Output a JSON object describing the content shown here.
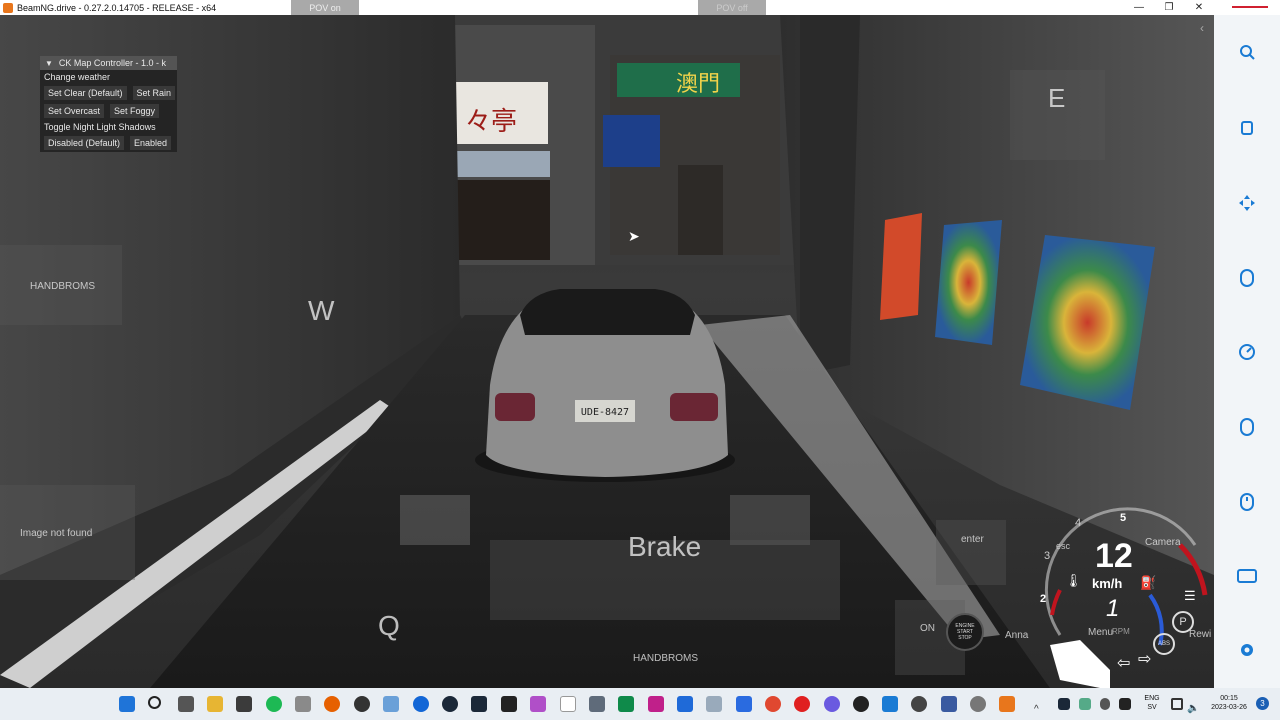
{
  "window": {
    "title": "BeamNG.drive - 0.27.2.0.14705 - RELEASE - x64",
    "controls": [
      "—",
      "❐",
      "✕"
    ]
  },
  "pov": {
    "on_label": "POV on",
    "off_label": "POV off"
  },
  "ck_panel": {
    "title": "CK Map Controller - 1.0 - k",
    "weather_label": "Change weather",
    "btn_clear": "Set Clear (Default)",
    "btn_rain": "Set Rain",
    "btn_overcast": "Set Overcast",
    "btn_foggy": "Set Foggy",
    "shadows_label": "Toggle Night Light Shadows",
    "btn_disabled": "Disabled (Default)",
    "btn_enabled": "Enabled"
  },
  "controls_overlay": {
    "key_e": "E",
    "key_w": "W",
    "key_q": "Q",
    "brake": "Brake",
    "handbrake_left": "HANDBROMS",
    "handbrake_bottom": "HANDBROMS",
    "image_missing": "Image not found",
    "enter": "enter",
    "esc": "esc",
    "camera": "Camera",
    "on": "ON",
    "engine": "ENGINE START STOP",
    "anna": "Anna",
    "menu": "Menu",
    "rewind": "Rewi"
  },
  "dashboard": {
    "speed": "12",
    "unit": "km/h",
    "gear": "1",
    "rpm_label": "RPM",
    "tach_marks": [
      "2",
      "3",
      "4",
      "5"
    ],
    "parking": "P",
    "abs": "ABS"
  },
  "scene": {
    "plate": "UDE-8427",
    "shop_sign": "澳門",
    "restaurant_sign": "々亭"
  },
  "taskbar": {
    "lang_top": "ENG",
    "lang_bottom": "SV",
    "time": "00:15",
    "date": "2023-03-26",
    "notif_count": "3"
  },
  "colors": {
    "taskbar_bg": "#e9eef3",
    "sidebar_bg": "#f2f5f8",
    "sidebar_icon": "#1a7bd4",
    "accent_red": "#c0141e"
  }
}
